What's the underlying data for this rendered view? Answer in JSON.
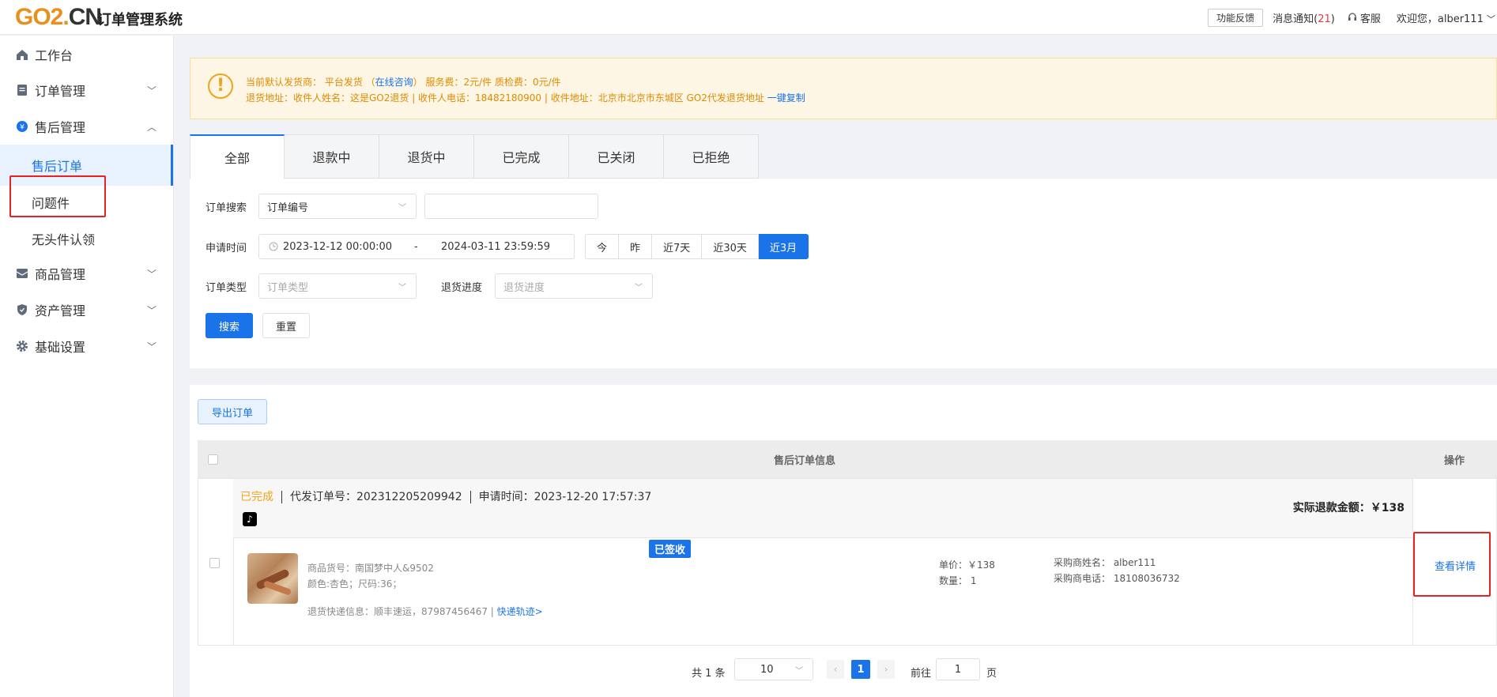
{
  "header": {
    "logo_go": "GO2.",
    "logo_cn": "CN",
    "system_title": "订单管理系统",
    "feedback": "功能反馈",
    "notice_label": "消息通知(",
    "notice_count": "21",
    "notice_close": ")",
    "service": "客服",
    "welcome": "欢迎您，alber111"
  },
  "sidebar": {
    "items": [
      {
        "label": "工作台",
        "icon": "home-icon"
      },
      {
        "label": "订单管理",
        "icon": "document-icon"
      },
      {
        "label": "售后管理",
        "icon": "yen-icon"
      },
      {
        "label": "商品管理",
        "icon": "box-icon"
      },
      {
        "label": "资产管理",
        "icon": "shield-icon"
      },
      {
        "label": "基础设置",
        "icon": "gear-icon"
      }
    ],
    "subitems": [
      "售后订单",
      "问题件",
      "无头件认领"
    ]
  },
  "alert": {
    "line1_a": "当前默认发货商：  平台发货  （",
    "line1_link": "在线咨询",
    "line1_b": "）  服务费：2元/件 质检费：0元/件",
    "line2_a": "退货地址：收件人姓名：这是GO2退货 | 收件人电话：18482180900 | 收件地址：北京市北京市东城区 GO2代发退货地址 ",
    "line2_link": "一键复制"
  },
  "tabs": [
    "全部",
    "退款中",
    "退货中",
    "已完成",
    "已关闭",
    "已拒绝"
  ],
  "filters": {
    "search_label": "订单搜索",
    "search_type": "订单编号",
    "search_value": "",
    "time_label": "申请时间",
    "time_start": "2023-12-12 00:00:00",
    "time_dash": "-",
    "time_end": "2024-03-11 23:59:59",
    "quick": [
      "今",
      "昨",
      "近7天",
      "近30天",
      "近3月"
    ],
    "type_label": "订单类型",
    "type_placeholder": "订单类型",
    "progress_label": "退货进度",
    "progress_placeholder": "退货进度",
    "search_btn": "搜索",
    "reset_btn": "重置"
  },
  "results": {
    "export_btn": "导出订单",
    "col_info": "售后订单信息",
    "col_op": "操作",
    "order": {
      "status": "已完成",
      "order_no": "代发订单号：202312205209942",
      "apply_time": "申请时间：2023-12-20 17:57:37",
      "refund_label": "实际退款金额：￥138",
      "product_sku": "商品货号：南国梦中人&9502",
      "product_spec": "颜色:杏色；尺码:36；",
      "return_express": "退货快递信息：顺丰速运，87987456467 | ",
      "express_link": "快递轨迹>",
      "sign_status": "已签收",
      "unit_price": "单价：￥138",
      "quantity": "数量：  1",
      "buyer_name": "采购商姓名：  alber111",
      "buyer_phone": "采购商电话：  18108036732",
      "detail_link": "查看详情"
    }
  },
  "pagination": {
    "total": "共 1 条",
    "page_size": "10",
    "current_page": "1",
    "goto_label": "前往",
    "goto_value": "1",
    "page_unit": "页"
  },
  "colors": {
    "primary": "#1a73e8",
    "warning": "#f0a31c",
    "highlight_box": "#e62222"
  }
}
